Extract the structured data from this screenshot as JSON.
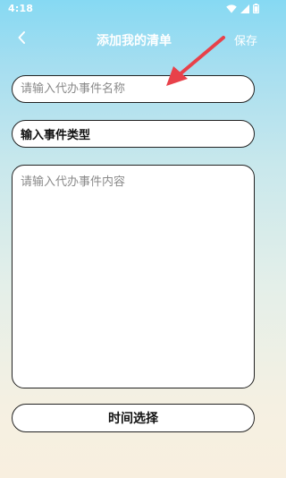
{
  "status_bar": {
    "time": "4:18",
    "icons": [
      "wifi-icon",
      "signal-icon",
      "battery-icon"
    ]
  },
  "app_bar": {
    "title": "添加我的清单",
    "save_label": "保存",
    "back_icon": "chevron-left-icon"
  },
  "form": {
    "name_placeholder": "请输入代办事件名称",
    "type_value": "输入事件类型",
    "content_placeholder": "请输入代办事件内容",
    "time_button_label": "时间选择"
  },
  "colors": {
    "gradient_top": "#86d9f3",
    "gradient_bottom": "#f8efdf",
    "border": "#222222",
    "annotation_arrow": "#e8414a"
  }
}
